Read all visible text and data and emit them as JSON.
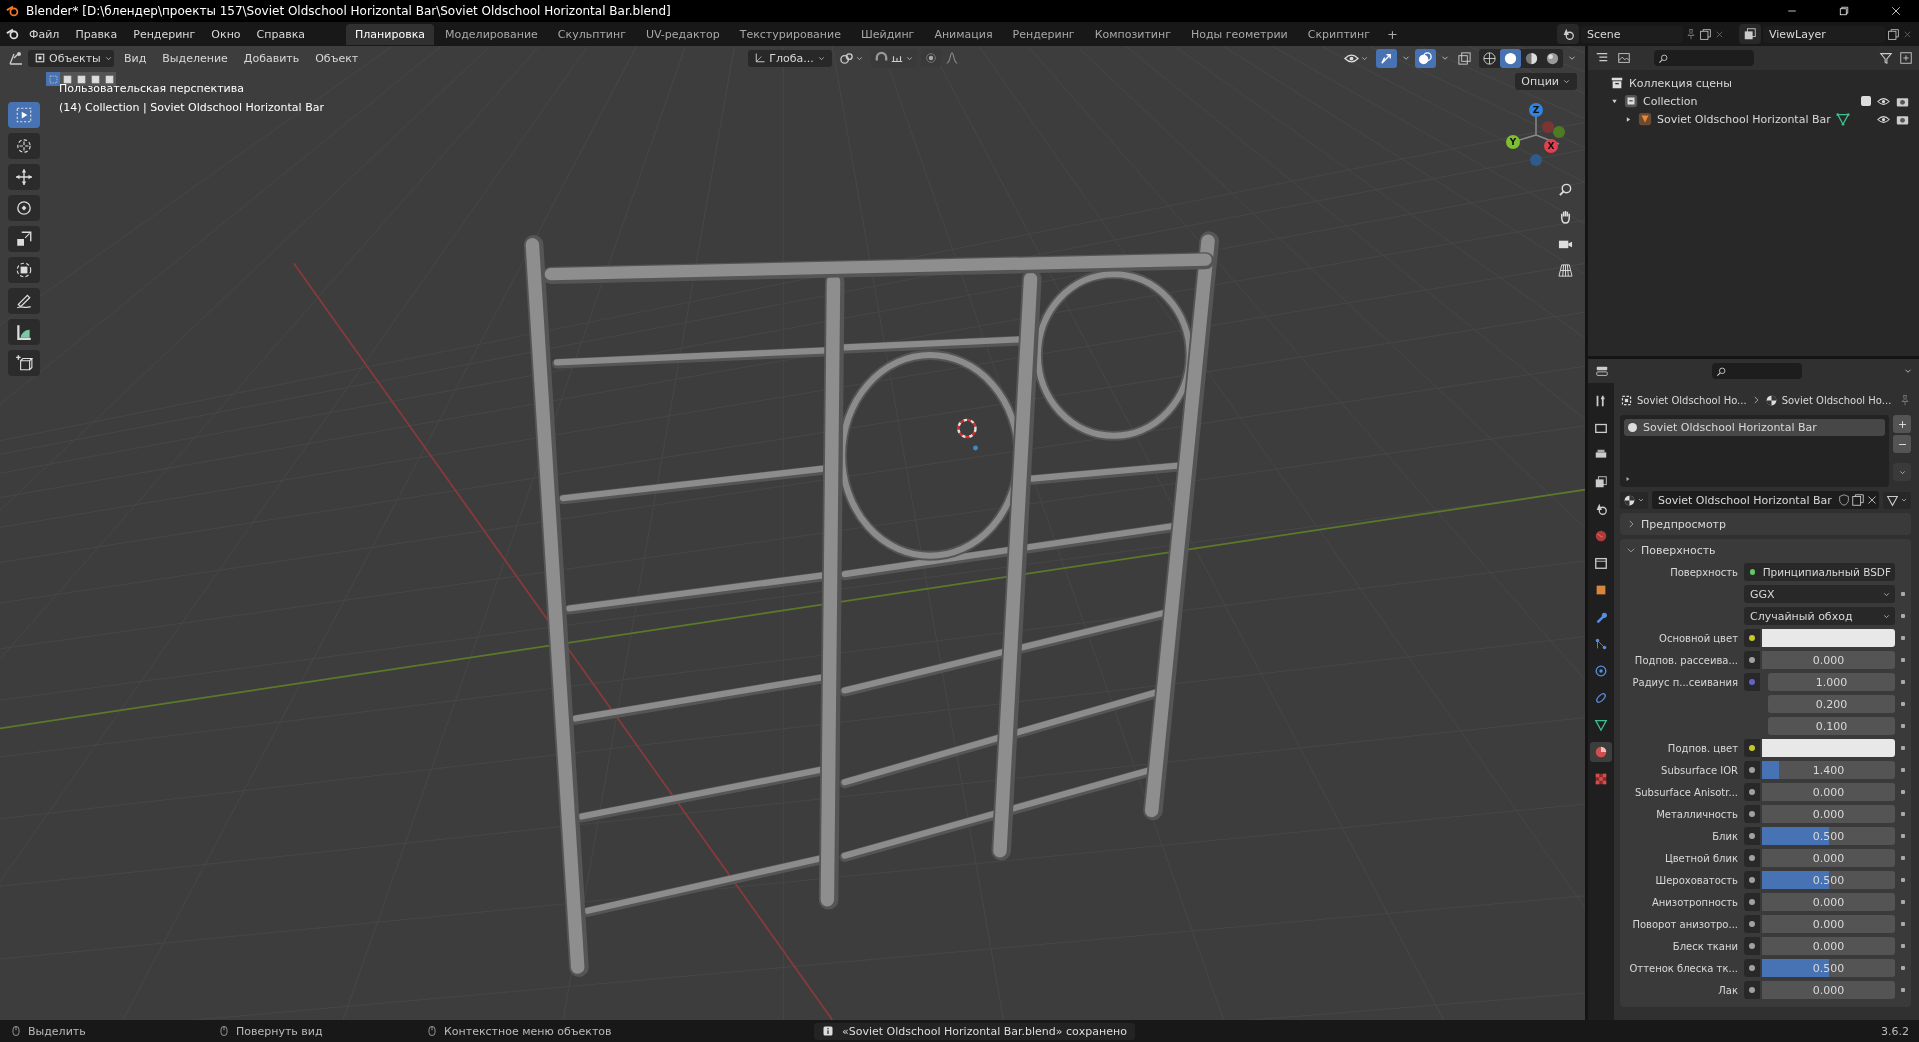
{
  "window": {
    "title": "Blender* [D:\\блендер\\проекты 157\\Soviet Oldschool Horizontal Bar\\Soviet Oldschool Horizontal Bar.blend]"
  },
  "menu": [
    "Файл",
    "Правка",
    "Рендеринг",
    "Окно",
    "Справка"
  ],
  "workspaces": [
    {
      "label": "Планировка",
      "selected": true
    },
    {
      "label": "Моделирование",
      "selected": false
    },
    {
      "label": "Скульптинг",
      "selected": false
    },
    {
      "label": "UV-редактор",
      "selected": false
    },
    {
      "label": "Текстурирование",
      "selected": false
    },
    {
      "label": "Шейдинг",
      "selected": false
    },
    {
      "label": "Анимация",
      "selected": false
    },
    {
      "label": "Рендеринг",
      "selected": false
    },
    {
      "label": "Композитинг",
      "selected": false
    },
    {
      "label": "Ноды геометрии",
      "selected": false
    },
    {
      "label": "Скриптинг",
      "selected": false
    }
  ],
  "add_workspace": "+",
  "scene": "Scene",
  "view_layer": "ViewLayer",
  "viewport": {
    "mode": "Объекты",
    "menus": [
      "Вид",
      "Выделение",
      "Добавить",
      "Объект"
    ],
    "orientation": "Глоба...",
    "options": "Опции",
    "select_modes": [
      {
        "selected": true
      },
      {
        "selected": false
      },
      {
        "selected": false
      },
      {
        "selected": false
      },
      {
        "selected": false
      }
    ],
    "shading": [
      {
        "kind": "wireframe",
        "selected": false
      },
      {
        "kind": "solid",
        "selected": true
      },
      {
        "kind": "material",
        "selected": false
      },
      {
        "kind": "rendered",
        "selected": false
      }
    ],
    "overlay_text": [
      "Пользовательская перспектива",
      "(14) Collection | Soviet Oldschool Horizontal Bar"
    ],
    "gizmo": [
      "Z",
      "Y",
      "X"
    ],
    "tools": [
      {
        "kind": "select",
        "selected": true
      },
      {
        "kind": "cursor",
        "selected": false
      },
      {
        "kind": "move",
        "selected": false
      },
      {
        "kind": "rotate",
        "selected": false
      },
      {
        "kind": "scale",
        "selected": false
      },
      {
        "kind": "transform",
        "selected": false
      },
      {
        "kind": "annotate",
        "selected": false
      },
      {
        "kind": "measure",
        "selected": false
      },
      {
        "kind": "add_cube",
        "selected": false
      }
    ]
  },
  "outliner": {
    "tree": [
      {
        "label": "Коллекция сцены",
        "kind": "scene_collection",
        "children": [
          {
            "label": "Collection",
            "kind": "collection",
            "expanded": true,
            "checked": true,
            "children": [
              {
                "label": "Soviet Oldschool Horizontal Bar",
                "kind": "object",
                "expanded": false
              }
            ]
          }
        ]
      }
    ]
  },
  "properties": {
    "tabs": [
      {
        "kind": "tool",
        "selected": false
      },
      {
        "kind": "render",
        "selected": false
      },
      {
        "kind": "output",
        "selected": false
      },
      {
        "kind": "view_layer",
        "selected": false
      },
      {
        "kind": "scene",
        "selected": false
      },
      {
        "kind": "world",
        "selected": false
      },
      {
        "kind": "collection",
        "selected": false
      },
      {
        "kind": "object",
        "selected": false
      },
      {
        "kind": "modifiers",
        "selected": false
      },
      {
        "kind": "particles",
        "selected": false
      },
      {
        "kind": "physics",
        "selected": false
      },
      {
        "kind": "constraints",
        "selected": false
      },
      {
        "kind": "data",
        "selected": false
      },
      {
        "kind": "material",
        "selected": true
      },
      {
        "kind": "texture",
        "selected": false
      }
    ],
    "breadcrumb": [
      "Soviet Oldschool Ho...",
      "Soviet Oldschool Ho..."
    ],
    "slots": [
      {
        "label": "Soviet Oldschool Horizontal Bar",
        "selected": true
      }
    ],
    "material": "Soviet Oldschool Horizontal Bar",
    "panels": [
      {
        "label": "Предпросмотр",
        "expanded": false
      },
      {
        "label": "Поверхность",
        "expanded": true
      }
    ],
    "rows": [
      {
        "kind": "shader",
        "label": "Поверхность",
        "value": "Принципиальный BSDF",
        "color": "#63c763"
      },
      {
        "kind": "enum",
        "value": "GGX"
      },
      {
        "kind": "enum",
        "value": "Случайный обход"
      },
      {
        "kind": "color",
        "label": "Основной цвет",
        "color": "#c7c729"
      },
      {
        "kind": "number",
        "label": "Подпов. рассеива...",
        "value": "0.000",
        "color": "#a1a1a1"
      },
      {
        "kind": "vector",
        "label": "Радиус п...сеивания",
        "values": [
          "1.000",
          "0.200",
          "0.100"
        ],
        "color": "#6363c7"
      },
      {
        "kind": "color",
        "label": "Подпов. цвет",
        "color": "#c7c729"
      },
      {
        "kind": "slider",
        "label": "Subsurface IOR",
        "value": "1.400",
        "level": 0.13,
        "color": "#a1a1a1"
      },
      {
        "kind": "number",
        "label": "Subsurface Anisotr...",
        "value": "0.000",
        "color": "#a1a1a1"
      },
      {
        "kind": "number",
        "label": "Металличность",
        "value": "0.000",
        "color": "#a1a1a1"
      },
      {
        "kind": "slider",
        "label": "Блик",
        "value": "0.500",
        "level": 0.5,
        "color": "#a1a1a1"
      },
      {
        "kind": "number",
        "label": "Цветной блик",
        "value": "0.000",
        "color": "#a1a1a1"
      },
      {
        "kind": "slider",
        "label": "Шероховатость",
        "value": "0.500",
        "level": 0.5,
        "color": "#a1a1a1"
      },
      {
        "kind": "number",
        "label": "Анизотропность",
        "value": "0.000",
        "color": "#a1a1a1"
      },
      {
        "kind": "number",
        "label": "Поворот анизотро...",
        "value": "0.000",
        "color": "#a1a1a1"
      },
      {
        "kind": "number",
        "label": "Блеск ткани",
        "value": "0.000",
        "color": "#a1a1a1"
      },
      {
        "kind": "slider",
        "label": "Оттенок блеска тк...",
        "value": "0.500",
        "level": 0.5,
        "color": "#a1a1a1"
      },
      {
        "kind": "number",
        "label": "Лак",
        "value": "0.000",
        "color": "#a1a1a1"
      }
    ]
  },
  "status_bar": {
    "hints": [
      "Выделить",
      "Повернуть вид",
      "Контекстное меню объектов"
    ],
    "message": "«Soviet Oldschool Horizontal Bar.blend» сохранено",
    "version": "3.6.2"
  }
}
